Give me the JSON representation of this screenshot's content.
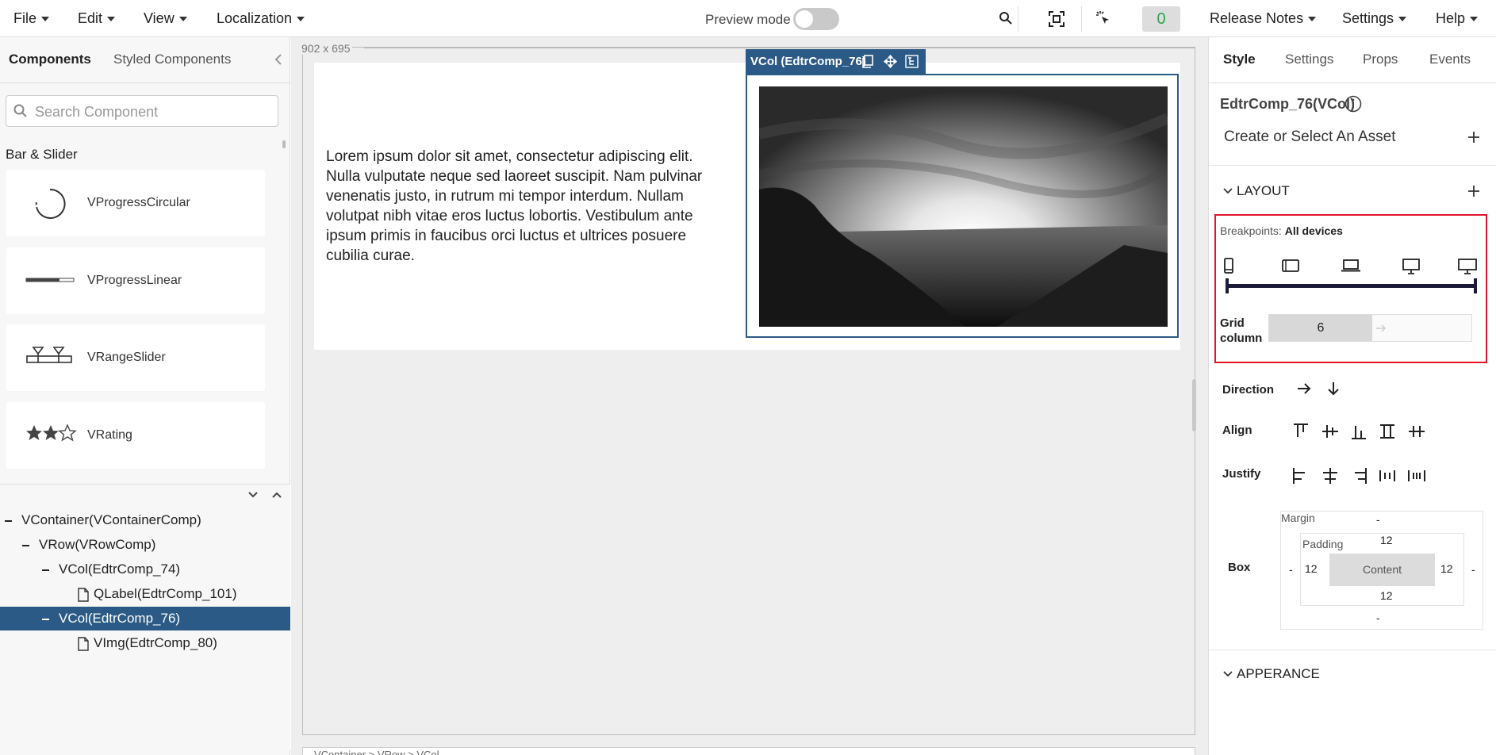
{
  "menubar": {
    "file": "File",
    "edit": "Edit",
    "view": "View",
    "localization": "Localization",
    "preview_mode": "Preview mode",
    "counter": "0",
    "release_notes": "Release Notes",
    "settings": "Settings",
    "help": "Help"
  },
  "left_panel": {
    "tabs": [
      "Components",
      "Styled Components"
    ],
    "search_placeholder": "Search Component",
    "section_title": "Bar & Slider",
    "components": [
      "VProgressCircular",
      "VProgressLinear",
      "VRangeSlider",
      "VRating"
    ]
  },
  "tree": {
    "items": [
      {
        "label": "VContainer(VContainerComp)",
        "selected": false
      },
      {
        "label": "VRow(VRowComp)",
        "selected": false
      },
      {
        "label": "VCol(EdtrComp_74)",
        "selected": false
      },
      {
        "label": "QLabel(EdtrComp_101)",
        "selected": false
      },
      {
        "label": "VCol(EdtrComp_76)",
        "selected": true
      },
      {
        "label": "VImg(EdtrComp_80)",
        "selected": false
      }
    ]
  },
  "canvas": {
    "size_label": "902 x 695",
    "lorem": "Lorem ipsum dolor sit amet, consectetur adipiscing elit. Nulla vulputate neque sed laoreet suscipit. Nam pulvinar venenatis justo, in rutrum mi tempor interdum. Nullam volutpat nibh vitae eros luctus lobortis. Vestibulum ante ipsum primis in faucibus orci luctus et ultrices posuere cubilia curae.",
    "selected_label": "VCol (EdtrComp_76)",
    "breadcrumb": "VContainer > VRow > VCol"
  },
  "right_panel": {
    "tabs": [
      "Style",
      "Settings",
      "Props",
      "Events"
    ],
    "component_title": "EdtrComp_76(VCol)",
    "asset_label": "Create or Select An Asset",
    "layout_title": "LAYOUT",
    "breakpoints_label": "Breakpoints:",
    "breakpoints_value": "All devices",
    "grid_column_label": "Grid column",
    "grid_column_value": "6",
    "direction_label": "Direction",
    "align_label": "Align",
    "justify_label": "Justify",
    "box_label": "Box",
    "margin_label": "Margin",
    "padding_label": "Padding",
    "content_label": "Content",
    "margin": {
      "top": "-",
      "bottom": "-",
      "left": "-",
      "right": "-"
    },
    "padding": {
      "top": "12",
      "bottom": "12",
      "left": "12",
      "right": "12"
    },
    "appearance_title": "APPERANCE"
  }
}
